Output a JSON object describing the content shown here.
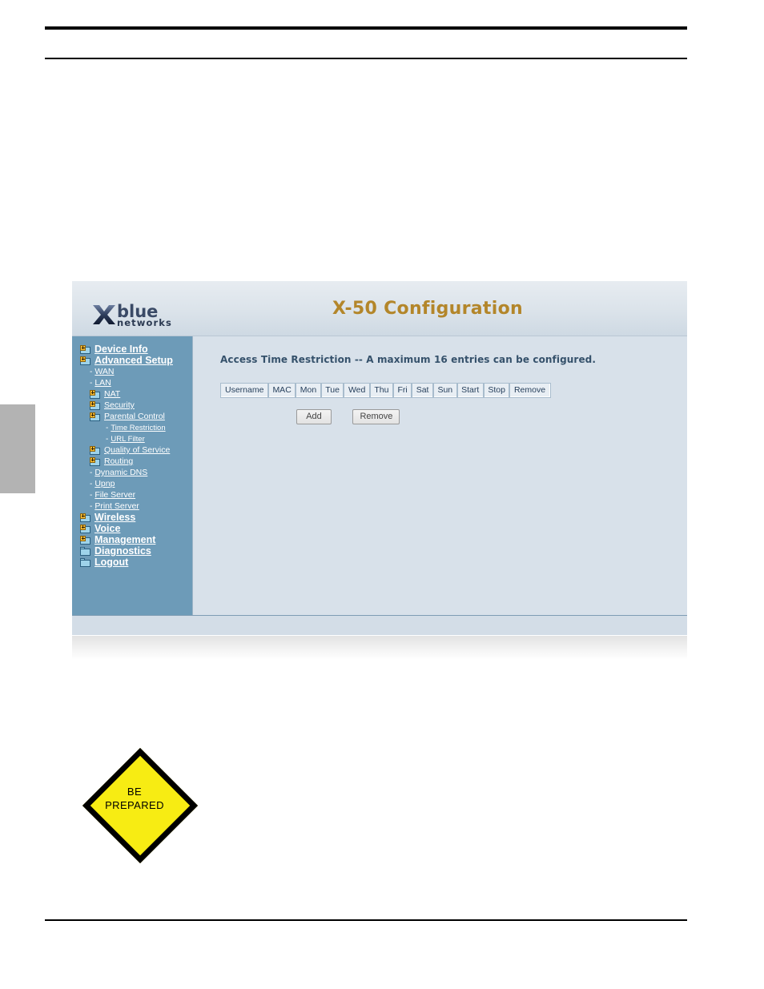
{
  "page": {
    "rules": [
      "top-thick-rule",
      "top-thin-rule",
      "bottom-thin-rule"
    ],
    "edge_tab": "page-edge-tab"
  },
  "router_ui": {
    "logo": {
      "icon": "xblue-x-icon",
      "word": "blue",
      "subword": "networks"
    },
    "title": "X-50 Configuration",
    "title_color": "#b3862a",
    "sidebar_bg": "#6d9bb8",
    "content_bg": "#d8e1ea",
    "sidebar": {
      "items": [
        {
          "label": "Device Info",
          "level": 0,
          "icon": "folder-plus-icon",
          "style": "top"
        },
        {
          "label": "Advanced Setup",
          "level": 0,
          "icon": "folder-plus-icon",
          "style": "top"
        },
        {
          "label": "WAN",
          "level": 1,
          "icon": "dash-bullet",
          "style": "sub"
        },
        {
          "label": "LAN",
          "level": 1,
          "icon": "dash-bullet",
          "style": "sub"
        },
        {
          "label": "NAT",
          "level": 1,
          "icon": "folder-plus-icon",
          "style": "sub"
        },
        {
          "label": "Security",
          "level": 1,
          "icon": "folder-plus-icon",
          "style": "sub"
        },
        {
          "label": "Parental Control",
          "level": 1,
          "icon": "folder-plus-icon",
          "style": "sub"
        },
        {
          "label": "Time Restriction",
          "level": 2,
          "icon": "dash-bullet",
          "style": "leaf2"
        },
        {
          "label": "URL Filter",
          "level": 2,
          "icon": "dash-bullet",
          "style": "leaf2"
        },
        {
          "label": "Quality of Service",
          "level": 1,
          "icon": "folder-plus-icon",
          "style": "sub"
        },
        {
          "label": "Routing",
          "level": 1,
          "icon": "folder-plus-icon",
          "style": "sub"
        },
        {
          "label": "Dynamic DNS",
          "level": 1,
          "icon": "dash-bullet",
          "style": "sub"
        },
        {
          "label": "Upnp",
          "level": 1,
          "icon": "dash-bullet",
          "style": "sub"
        },
        {
          "label": "File Server",
          "level": 1,
          "icon": "dash-bullet",
          "style": "sub"
        },
        {
          "label": "Print Server",
          "level": 1,
          "icon": "dash-bullet",
          "style": "sub"
        },
        {
          "label": "Wireless",
          "level": 0,
          "icon": "folder-plus-icon",
          "style": "top"
        },
        {
          "label": "Voice",
          "level": 0,
          "icon": "folder-plus-icon",
          "style": "top"
        },
        {
          "label": "Management",
          "level": 0,
          "icon": "folder-plus-icon",
          "style": "top"
        },
        {
          "label": "Diagnostics",
          "level": 0,
          "icon": "folder-icon",
          "style": "top"
        },
        {
          "label": "Logout",
          "level": 0,
          "icon": "folder-icon",
          "style": "top"
        }
      ]
    },
    "content": {
      "heading": "Access Time Restriction -- A maximum 16 entries can be configured.",
      "table": {
        "columns": [
          "Username",
          "MAC",
          "Mon",
          "Tue",
          "Wed",
          "Thu",
          "Fri",
          "Sat",
          "Sun",
          "Start",
          "Stop",
          "Remove"
        ],
        "rows": []
      },
      "buttons": [
        {
          "label": "Add"
        },
        {
          "label": "Remove"
        }
      ]
    }
  },
  "sign": {
    "line1": "BE",
    "line2": "PREPARED",
    "fill_color": "#f7ec13",
    "border_color": "#000000"
  }
}
